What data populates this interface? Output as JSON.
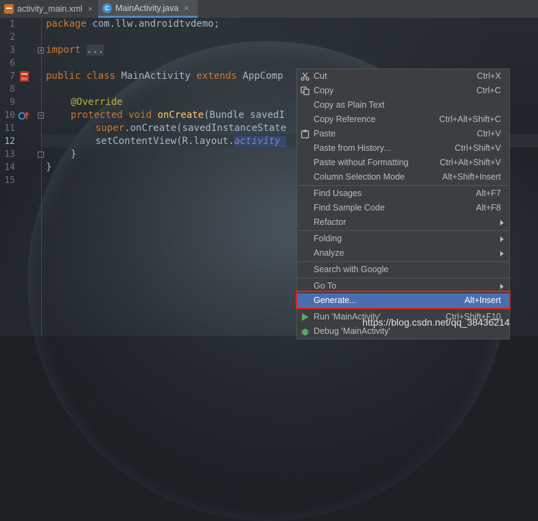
{
  "tabs": [
    {
      "name": "activity_main.xml",
      "icon": "xml-file-icon",
      "close": "×"
    },
    {
      "name": "MainActivity.java",
      "icon": "java-class-icon",
      "close": "×"
    }
  ],
  "gutter": {
    "line_numbers": [
      "1",
      "2",
      "3",
      "6",
      "7",
      "8",
      "9",
      "10",
      "11",
      "12",
      "13",
      "14",
      "15"
    ],
    "current_line": "12"
  },
  "code": {
    "l1_kw": "package",
    "l1_rest": " com.llw.androidtvdemo;",
    "l3_kw": "import",
    "l3_fold": "...",
    "l7_kw1": "public class",
    "l7_name": " MainActivity ",
    "l7_kw2": "extends",
    "l7_rest": " AppComp",
    "l9_ann": "@Override",
    "l10_kw": "protected void",
    "l10_fn": " onCreate",
    "l10_rest": "(Bundle savedI",
    "l11_kw": "super",
    "l11_rest": ".onCreate(savedInstanceState",
    "l12_rest": "setContentView(R.layout.",
    "l12_fld": "activity_",
    "l13": "}",
    "l14": "}"
  },
  "menu": {
    "items": [
      {
        "label": "Cut",
        "shortcut": "Ctrl+X",
        "icon": "scissors-icon"
      },
      {
        "label": "Copy",
        "shortcut": "Ctrl+C",
        "icon": "copy-icon"
      },
      {
        "label": "Copy as Plain Text",
        "shortcut": ""
      },
      {
        "label": "Copy Reference",
        "shortcut": "Ctrl+Alt+Shift+C"
      },
      {
        "label": "Paste",
        "shortcut": "Ctrl+V",
        "icon": "paste-icon"
      },
      {
        "label": "Paste from History...",
        "shortcut": "Ctrl+Shift+V"
      },
      {
        "label": "Paste without Formatting",
        "shortcut": "Ctrl+Alt+Shift+V"
      },
      {
        "label": "Column Selection Mode",
        "shortcut": "Alt+Shift+Insert"
      },
      {
        "label": "Find Usages",
        "shortcut": "Alt+F7"
      },
      {
        "label": "Find Sample Code",
        "shortcut": "Alt+F8"
      },
      {
        "label": "Refactor",
        "submenu": true
      },
      {
        "label": "Folding",
        "submenu": true
      },
      {
        "label": "Analyze",
        "submenu": true
      },
      {
        "label": "Search with Google",
        "shortcut": ""
      },
      {
        "label": "Go To",
        "submenu": true
      },
      {
        "label": "Generate...",
        "shortcut": "Alt+Insert",
        "highlighted": true
      },
      {
        "label": "Run 'MainActivity'",
        "shortcut": "Ctrl+Shift+F10",
        "icon": "run-icon"
      },
      {
        "label": "Debug 'MainActivity'",
        "shortcut": "",
        "icon": "debug-icon"
      }
    ]
  },
  "watermark": "https://blog.csdn.net/qq_38436214",
  "colors": {
    "menu_bg": "#3c3f41",
    "highlight": "#4b6eaf",
    "annotation_box": "#e0231b",
    "editor_bg": "#1c2126"
  }
}
